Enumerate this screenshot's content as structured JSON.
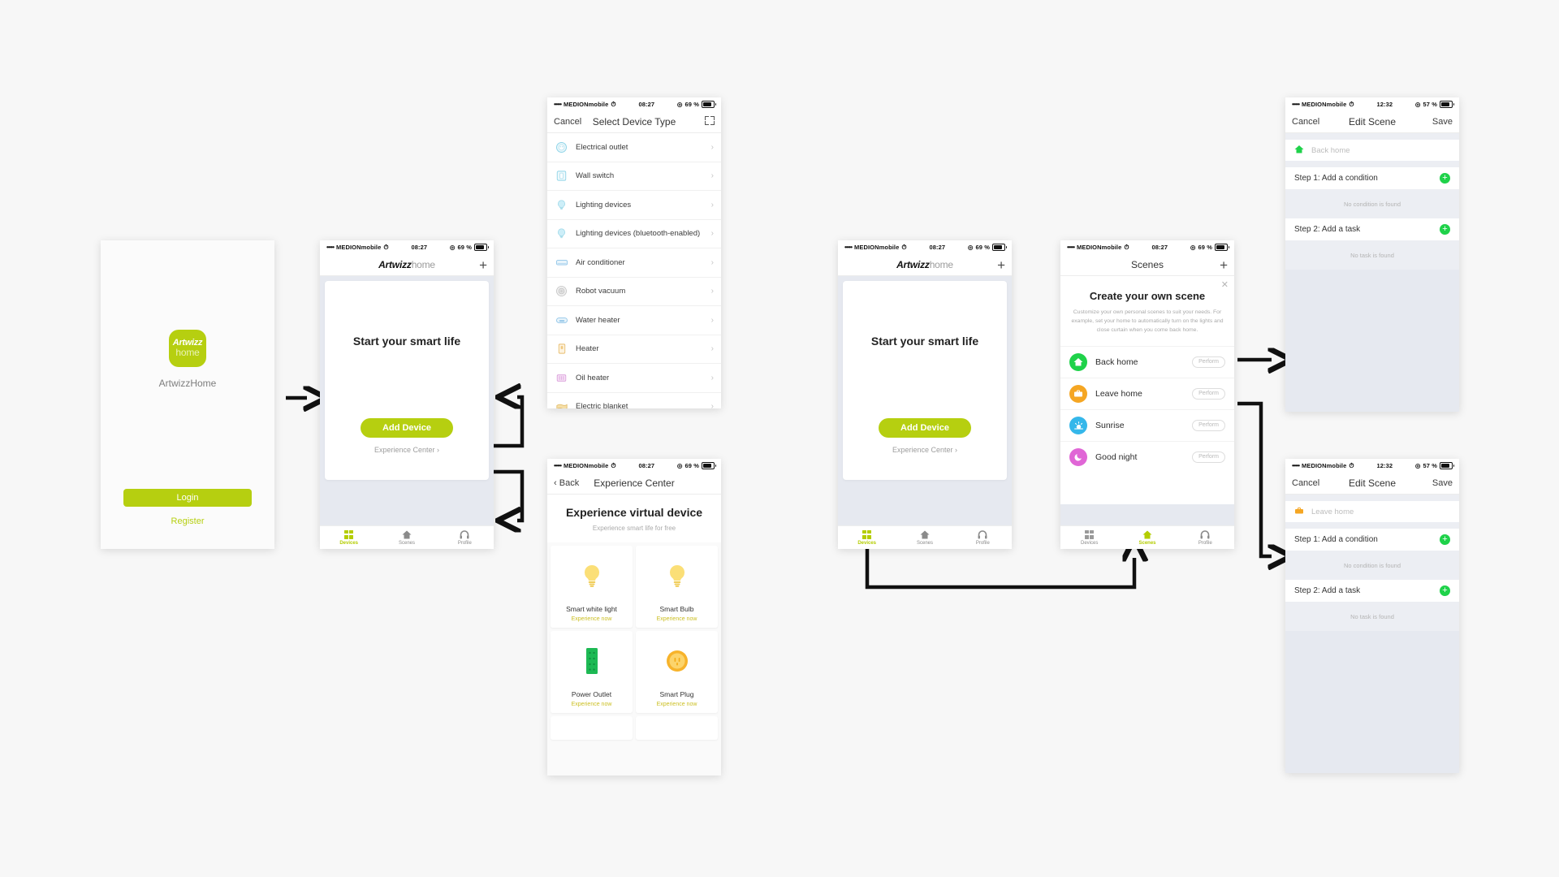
{
  "accent": {
    "brand_green": "#b6cf10",
    "scene_green": "#1fd24a",
    "orange": "#f5a623",
    "blue": "#35b7ea",
    "pink": "#e066d6"
  },
  "status_bars": {
    "carrier": "MEDIONmobile",
    "dots": "•••••",
    "time_0827": "08:27",
    "time_1232": "12:32",
    "battery_69": "69 %",
    "battery_57": "57 %"
  },
  "login_screen": {
    "logo_line1": "Artwizz",
    "logo_line2": "home",
    "app_name": "ArtwizzHome",
    "login_label": "Login",
    "register_label": "Register"
  },
  "devices_screen": {
    "brand_bold": "Artwizz",
    "brand_light": "home",
    "add_label": "+",
    "headline": "Start your smart life",
    "add_device_label": "Add Device",
    "experience_center_label": "Experience Center ›",
    "tabs": [
      {
        "label": "Devices",
        "icon": "grid-icon",
        "active": true
      },
      {
        "label": "Scenes",
        "icon": "home-icon",
        "active": false
      },
      {
        "label": "Profile",
        "icon": "headset-icon",
        "active": false
      }
    ]
  },
  "device_type_screen": {
    "cancel_label": "Cancel",
    "title": "Select Device Type",
    "scan_icon": "scan-icon",
    "rows": [
      {
        "label": "Electrical outlet",
        "icon": "outlet-icon"
      },
      {
        "label": "Wall switch",
        "icon": "switch-icon"
      },
      {
        "label": "Lighting devices",
        "icon": "bulb-icon"
      },
      {
        "label": "Lighting devices (bluetooth-enabled)",
        "icon": "bulb-icon"
      },
      {
        "label": "Air conditioner",
        "icon": "ac-icon"
      },
      {
        "label": "Robot vacuum",
        "icon": "vacuum-icon"
      },
      {
        "label": "Water heater",
        "icon": "water-heater-icon"
      },
      {
        "label": "Heater",
        "icon": "heater-icon"
      },
      {
        "label": "Oil heater",
        "icon": "oil-heater-icon"
      },
      {
        "label": "Electric blanket",
        "icon": "blanket-icon"
      }
    ],
    "chevron": "›"
  },
  "experience_center_screen": {
    "back_label": "Back",
    "title": "Experience Center",
    "headline": "Experience virtual device",
    "subhead": "Experience smart life for free",
    "cards": [
      {
        "name": "Smart white light",
        "cta": "Experience now",
        "icon": "bulb-white-icon"
      },
      {
        "name": "Smart Bulb",
        "cta": "Experience now",
        "icon": "bulb-yellow-icon"
      },
      {
        "name": "Power Outlet",
        "cta": "Experience now",
        "icon": "power-strip-icon"
      },
      {
        "name": "Smart Plug",
        "cta": "Experience now",
        "icon": "smart-plug-icon"
      }
    ]
  },
  "scenes_screen": {
    "title": "Scenes",
    "add_label": "+",
    "close_label": "✕",
    "promo_title": "Create your own scene",
    "promo_body": "Customize your own personal scenes to suit your needs. For example, set your home to automatically turn on the lights and close curtain when you come back home.",
    "rows": [
      {
        "name": "Back home",
        "perform": "Perform",
        "icon": "home-icon",
        "color": "#1fd24a"
      },
      {
        "name": "Leave home",
        "perform": "Perform",
        "icon": "briefcase-icon",
        "color": "#f5a623"
      },
      {
        "name": "Sunrise",
        "perform": "Perform",
        "icon": "sunrise-icon",
        "color": "#35b7ea"
      },
      {
        "name": "Good night",
        "perform": "Perform",
        "icon": "moon-icon",
        "color": "#e066d6"
      }
    ],
    "tabs": [
      {
        "label": "Devices",
        "icon": "grid-icon",
        "active": false
      },
      {
        "label": "Scenes",
        "icon": "home-icon",
        "active": true
      },
      {
        "label": "Profile",
        "icon": "headset-icon",
        "active": false
      }
    ]
  },
  "edit_scene_1": {
    "cancel_label": "Cancel",
    "title": "Edit Scene",
    "save_label": "Save",
    "scene_name_placeholder": "Back home",
    "scene_icon": "home-icon",
    "scene_icon_color": "#1fd24a",
    "step1_label": "Step 1: Add a condition",
    "step1_empty": "No condition is found",
    "step2_label": "Step 2: Add a task",
    "step2_empty": "No task is found",
    "add_icon": "plus-icon"
  },
  "edit_scene_2": {
    "cancel_label": "Cancel",
    "title": "Edit Scene",
    "save_label": "Save",
    "scene_name_placeholder": "Leave home",
    "scene_icon": "briefcase-icon",
    "scene_icon_color": "#f5a623",
    "step1_label": "Step 1: Add a condition",
    "step1_empty": "No condition is found",
    "step2_label": "Step 2: Add a task",
    "step2_empty": "No task is found",
    "add_icon": "plus-icon"
  }
}
